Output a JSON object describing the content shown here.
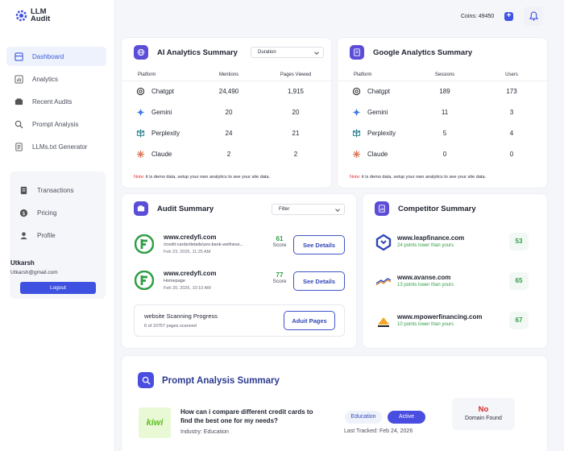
{
  "app": {
    "logo_line1": "LLM",
    "logo_line2": "Audit"
  },
  "sidebar": {
    "nav": [
      {
        "label": "Dashboard",
        "icon": "dashboard-icon",
        "active": true
      },
      {
        "label": "Analytics",
        "icon": "analytics-icon"
      },
      {
        "label": "Recent Audits",
        "icon": "audits-icon"
      },
      {
        "label": "Prompt Analysis",
        "icon": "search-icon"
      },
      {
        "label": "LLMs.txt Generator",
        "icon": "document-icon"
      }
    ],
    "account": [
      {
        "label": "Transactions",
        "icon": "transactions-icon"
      },
      {
        "label": "Pricing",
        "icon": "pricing-icon"
      },
      {
        "label": "Profile",
        "icon": "user-icon"
      }
    ],
    "user_name": "Utkarsh",
    "user_email": "Utkarsh@gmail.com",
    "logout_label": "Logout"
  },
  "header": {
    "coins_label": "Coins: 49450",
    "coins_add": "+"
  },
  "ai_summary": {
    "title": "AI Analytics Summary",
    "dropdown": "Duration",
    "headers": [
      "Platform",
      "Mentions",
      "Pages Viewed"
    ],
    "rows": [
      [
        "Chatgpt",
        "24,490",
        "1,915"
      ],
      [
        "Gemini",
        "20",
        "20"
      ],
      [
        "Perplexity",
        "24",
        "21"
      ],
      [
        "Claude",
        "2",
        "2"
      ]
    ],
    "note_label": "Note:",
    "note_text": " it is demo data, setup your own analytics to see your site data."
  },
  "google_summary": {
    "title": "Google Analytics Summary",
    "headers": [
      "Platform",
      "Sessions",
      "Users"
    ],
    "rows": [
      [
        "Chatgpt",
        "189",
        "173"
      ],
      [
        "Gemini",
        "11",
        "3"
      ],
      [
        "Perplexity",
        "5",
        "4"
      ],
      [
        "Claude",
        "0",
        "0"
      ]
    ],
    "note_label": "Note:",
    "note_text": " it is demo data, setup your own analytics to see your site data."
  },
  "audit_summary": {
    "title": "Audit Summary",
    "filter": "Filter",
    "items": [
      {
        "url": "www.credyfi.com",
        "path": "/credit-cards/details/yes-bank-wellness...",
        "date": "Feb 23, 2026, 11:25 AM",
        "score": "61",
        "score_label": "Score",
        "button": "See Details"
      },
      {
        "url": "www.credyfi.com",
        "path": "Homepage",
        "date": "Feb 20, 2026, 10:10 AM",
        "score": "77",
        "score_label": "Score",
        "button": "See Details"
      }
    ],
    "scan_title": "website Scanning Progress",
    "scan_status": "6 of 10757 pages scanned",
    "scan_button": "Aduit Pages"
  },
  "competitor_summary": {
    "title": "Competitor Summary",
    "items": [
      {
        "url": "www.leapfinance.com",
        "sub": "24 points lower than yours",
        "score": "53"
      },
      {
        "url": "www.avanse.com",
        "sub": "13 points lower than yours",
        "score": "65"
      },
      {
        "url": "www.mpowerfinancing.com",
        "sub": "10 points lower than yours",
        "score": "67"
      }
    ]
  },
  "prompt_analysis": {
    "title": "Prompt Analysis Summary",
    "brand": "kiwi",
    "question": "How can i compare different credit cards to find the best one for my needs?",
    "industry": "Industry: Education",
    "tag": "Education",
    "status": "Active",
    "tracked": "Last Tracked: Feb 24, 2026",
    "nd_line1": "No",
    "nd_line2": "Domain Found"
  },
  "colors": {
    "accent": "#3f51e0",
    "positive": "#2f9e44",
    "negative": "#d42a2a"
  }
}
